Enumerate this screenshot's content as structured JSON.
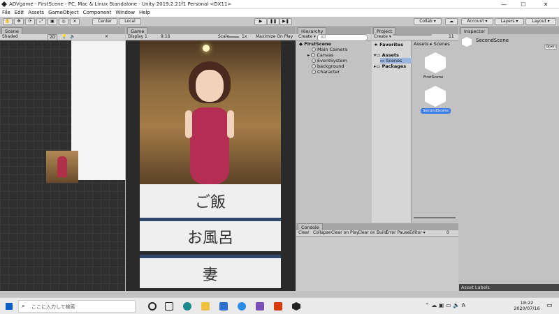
{
  "window": {
    "title": "ADVgame - FirstScene - PC, Mac & Linux Standalone - Unity 2019.2.21f1 Personal <DX11>",
    "minimize": "—",
    "maximize": "☐",
    "close": "✕"
  },
  "menu": [
    "File",
    "Edit",
    "Assets",
    "GameObject",
    "Component",
    "Window",
    "Help"
  ],
  "toolbar": {
    "center": "Center",
    "local": "Local",
    "collab": "Collab ▾",
    "account": "Account ▾",
    "layers": "Layers ▾",
    "layout": "Layout ▾"
  },
  "scene": {
    "tab": "Scene",
    "shading": "Shaded",
    "mode2d": "2D"
  },
  "game": {
    "tab": "Game",
    "display": "Display 1",
    "aspect": "9:16",
    "scale_label": "Scale",
    "scale_value": "1x",
    "maximize": "Maximize On Play",
    "mute": "M",
    "choices": [
      "ご飯",
      "お風呂",
      "妻"
    ]
  },
  "hierarchy": {
    "tab": "Hierarchy",
    "create": "Create ▾",
    "search_placeholder": "All",
    "scene": "FirstScene",
    "items": [
      "Main Camera",
      "Canvas",
      "EventSystem",
      "background",
      "Character"
    ]
  },
  "project": {
    "tab": "Project",
    "create": "Create ▾",
    "favorites": "Favorites",
    "assets": "Assets",
    "scenes": "Scenes",
    "packages": "Packages",
    "breadcrumb_assets": "Assets",
    "breadcrumb_scenes": "Scenes",
    "files": [
      "FirstScene",
      "SecondScene"
    ],
    "count": "11"
  },
  "inspector": {
    "tab": "Inspector",
    "object": "SecondScene",
    "open": "Open",
    "asset_labels": "Asset Labels"
  },
  "console": {
    "tab": "Console",
    "buttons": [
      "Clear",
      "Collapse",
      "Clear on Play",
      "Clear on Build",
      "Error Pause",
      "Editor ▾"
    ],
    "count": "0"
  },
  "taskbar": {
    "search_placeholder": "ここに入力して検索",
    "time": "18:22",
    "date": "2020/07/16"
  },
  "colors": {
    "accent": "#3d7ce6",
    "choice_bar": "#30476a"
  }
}
